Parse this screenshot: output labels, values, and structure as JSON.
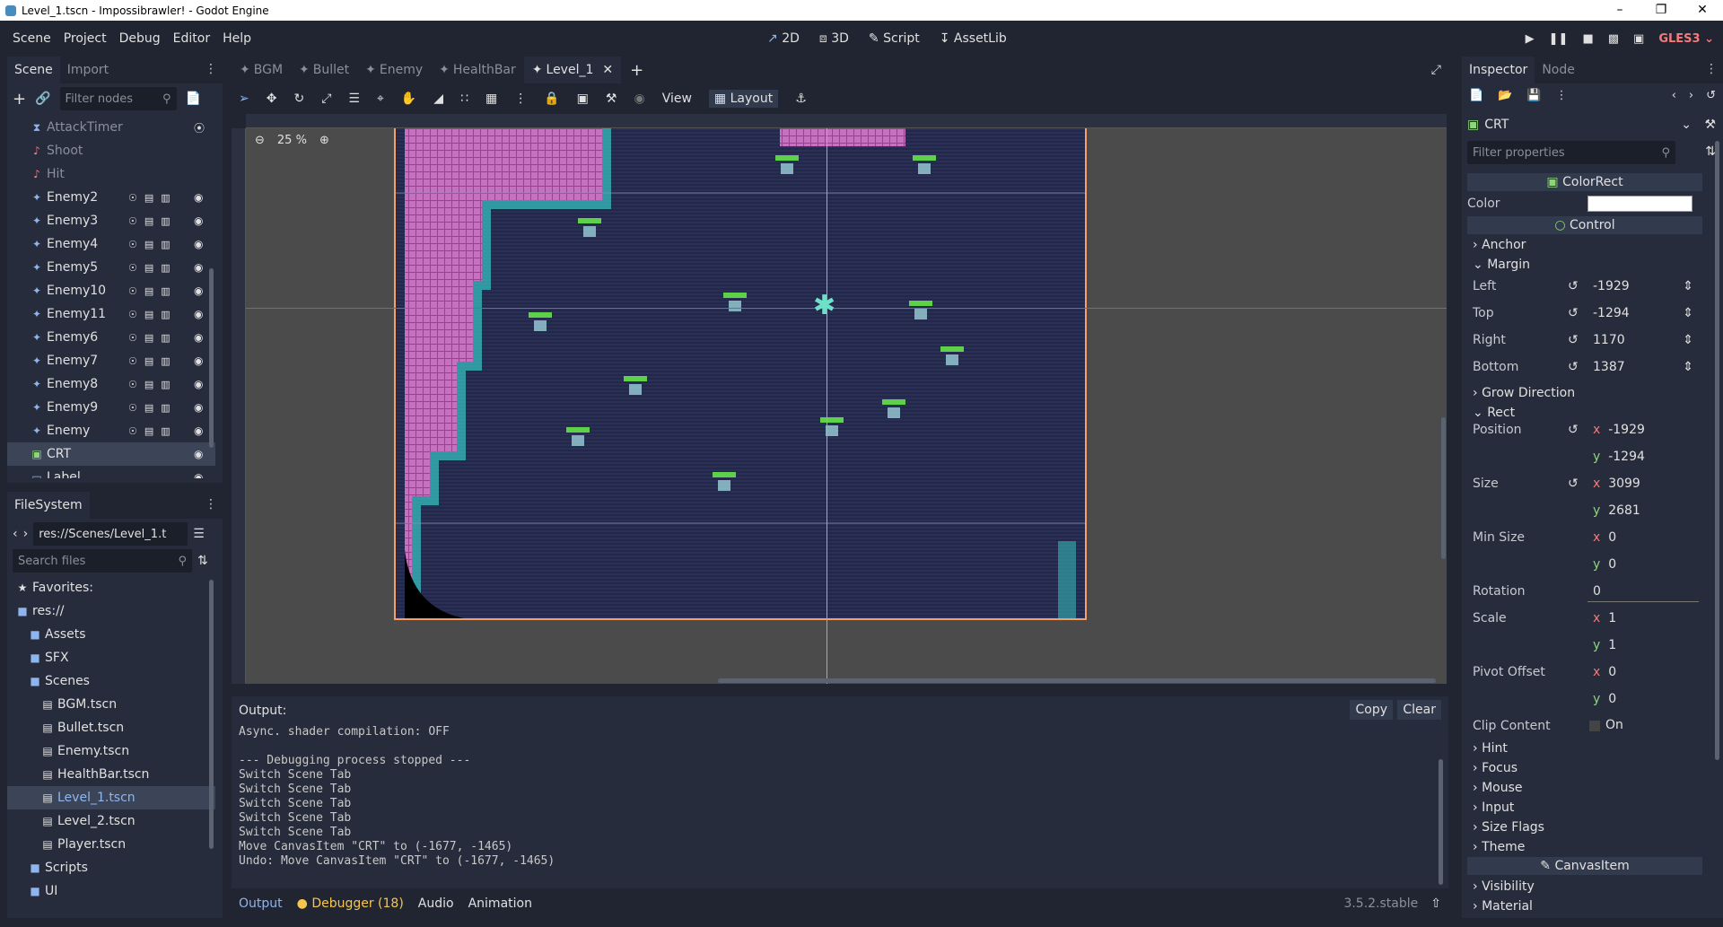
{
  "window": {
    "title": "Level_1.tscn - Impossibrawler! - Godot Engine"
  },
  "menus": [
    "Scene",
    "Project",
    "Debug",
    "Editor",
    "Help"
  ],
  "workspaces": [
    {
      "label": "2D",
      "icon": "2d-icon",
      "active": true
    },
    {
      "label": "3D",
      "icon": "3d-icon"
    },
    {
      "label": "Script",
      "icon": "script-icon"
    },
    {
      "label": "AssetLib",
      "icon": "assetlib-icon"
    }
  ],
  "renderer": "GLES3",
  "scene_dock": {
    "tabs": [
      "Scene",
      "Import"
    ],
    "filter_placeholder": "Filter nodes",
    "nodes": [
      {
        "label": "AttackTimer",
        "icon": "timer-icon",
        "dim": true
      },
      {
        "label": "Shoot",
        "icon": "audio-icon",
        "dim": true
      },
      {
        "label": "Hit",
        "icon": "audio-icon",
        "dim": true
      },
      {
        "label": "Enemy2",
        "icon": "scene-icon"
      },
      {
        "label": "Enemy3",
        "icon": "scene-icon"
      },
      {
        "label": "Enemy4",
        "icon": "scene-icon"
      },
      {
        "label": "Enemy5",
        "icon": "scene-icon"
      },
      {
        "label": "Enemy10",
        "icon": "scene-icon"
      },
      {
        "label": "Enemy11",
        "icon": "scene-icon"
      },
      {
        "label": "Enemy6",
        "icon": "scene-icon"
      },
      {
        "label": "Enemy7",
        "icon": "scene-icon"
      },
      {
        "label": "Enemy8",
        "icon": "scene-icon"
      },
      {
        "label": "Enemy9",
        "icon": "scene-icon"
      },
      {
        "label": "Enemy",
        "icon": "scene-icon"
      },
      {
        "label": "CRT",
        "icon": "colorrect-icon",
        "selected": true
      },
      {
        "label": "Label",
        "icon": "label-icon"
      }
    ]
  },
  "filesystem": {
    "title": "FileSystem",
    "path": "res://Scenes/Level_1.t",
    "search_placeholder": "Search files",
    "items": [
      {
        "label": "Favorites:",
        "indent": 0,
        "icon": "star-icon"
      },
      {
        "label": "res://",
        "indent": 0,
        "icon": "folder-icon"
      },
      {
        "label": "Assets",
        "indent": 1,
        "icon": "folder-icon"
      },
      {
        "label": "SFX",
        "indent": 1,
        "icon": "folder-icon"
      },
      {
        "label": "Scenes",
        "indent": 1,
        "icon": "folder-icon"
      },
      {
        "label": "BGM.tscn",
        "indent": 2,
        "icon": "scene-file-icon"
      },
      {
        "label": "Bullet.tscn",
        "indent": 2,
        "icon": "scene-file-icon"
      },
      {
        "label": "Enemy.tscn",
        "indent": 2,
        "icon": "scene-file-icon"
      },
      {
        "label": "HealthBar.tscn",
        "indent": 2,
        "icon": "scene-file-icon"
      },
      {
        "label": "Level_1.tscn",
        "indent": 2,
        "icon": "scene-file-icon",
        "selected": true
      },
      {
        "label": "Level_2.tscn",
        "indent": 2,
        "icon": "scene-file-icon"
      },
      {
        "label": "Player.tscn",
        "indent": 2,
        "icon": "scene-file-icon"
      },
      {
        "label": "Scripts",
        "indent": 1,
        "icon": "folder-icon"
      },
      {
        "label": "UI",
        "indent": 1,
        "icon": "folder-icon"
      }
    ]
  },
  "scene_tabs": [
    {
      "label": "BGM"
    },
    {
      "label": "Bullet"
    },
    {
      "label": "Enemy"
    },
    {
      "label": "HealthBar"
    },
    {
      "label": "Level_1",
      "active": true
    }
  ],
  "toolbar": {
    "view": "View",
    "layout": "Layout",
    "zoom": "25 %"
  },
  "output": {
    "label": "Output:",
    "copy": "Copy",
    "clear": "Clear",
    "lines": [
      "Async. shader compilation: OFF",
      "",
      "--- Debugging process stopped ---",
      "Switch Scene Tab",
      "Switch Scene Tab",
      "Switch Scene Tab",
      "Switch Scene Tab",
      "Switch Scene Tab",
      "Move CanvasItem \"CRT\" to (-1677, -1465)",
      "Undo: Move CanvasItem \"CRT\" to (-1677, -1465)"
    ]
  },
  "bottom_tabs": {
    "output": "Output",
    "debugger": "Debugger (18)",
    "audio": "Audio",
    "animation": "Animation",
    "version": "3.5.2.stable"
  },
  "inspector": {
    "tabs": [
      "Inspector",
      "Node"
    ],
    "object": "CRT",
    "filter_placeholder": "Filter properties",
    "colorrect_header": "ColorRect",
    "color_label": "Color",
    "color_value": "#ffffff",
    "control_header": "Control",
    "anchor": "Anchor",
    "margin": "Margin",
    "margins": [
      {
        "label": "Left",
        "value": "-1929"
      },
      {
        "label": "Top",
        "value": "-1294"
      },
      {
        "label": "Right",
        "value": "1170"
      },
      {
        "label": "Bottom",
        "value": "1387"
      }
    ],
    "grow_direction": "Grow Direction",
    "rect": "Rect",
    "position_label": "Position",
    "position": {
      "x": "-1929",
      "y": "-1294"
    },
    "size_label": "Size",
    "size": {
      "x": "3099",
      "y": "2681"
    },
    "min_size_label": "Min Size",
    "min_size": {
      "x": "0",
      "y": "0"
    },
    "rotation_label": "Rotation",
    "rotation": "0",
    "scale_label": "Scale",
    "scale": {
      "x": "1",
      "y": "1"
    },
    "pivot_label": "Pivot Offset",
    "pivot": {
      "x": "0",
      "y": "0"
    },
    "clip_label": "Clip Content",
    "clip_value": "On",
    "groups": [
      "Hint",
      "Focus",
      "Mouse",
      "Input",
      "Size Flags",
      "Theme"
    ],
    "canvasitem_header": "CanvasItem",
    "groups2": [
      "Visibility",
      "Material"
    ]
  }
}
